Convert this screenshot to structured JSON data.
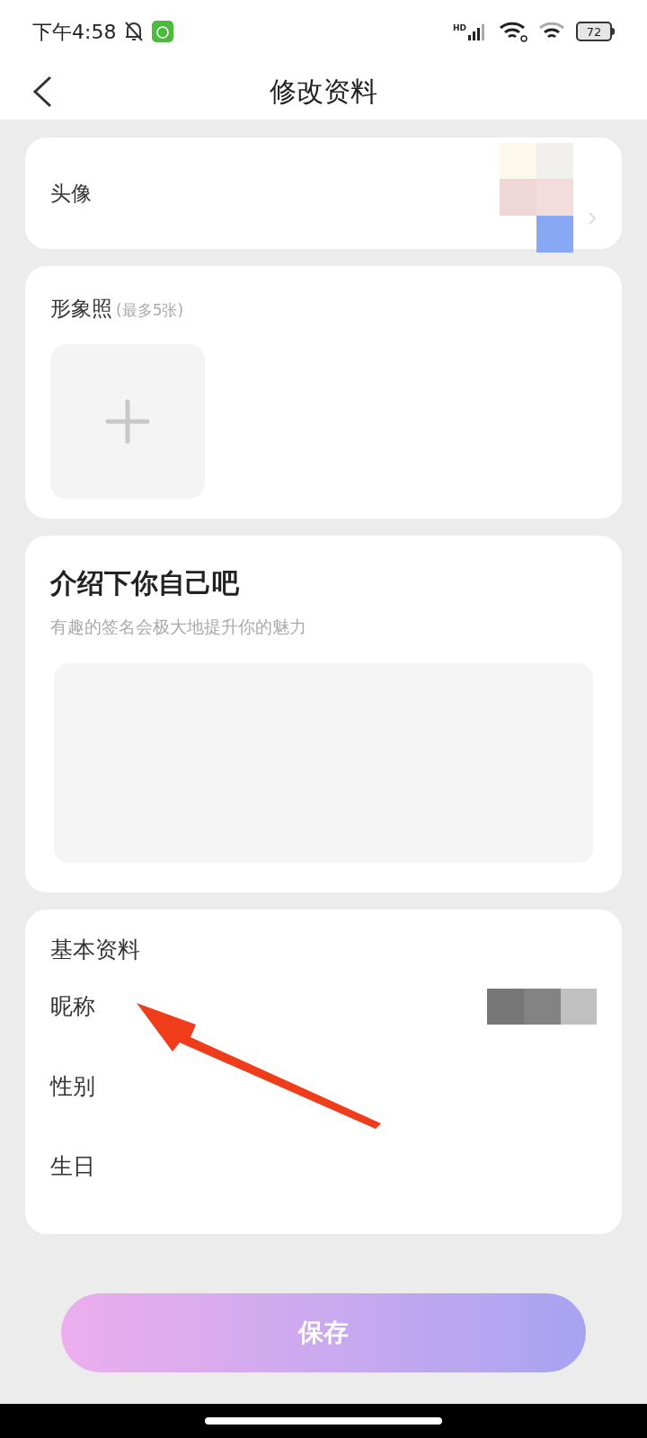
{
  "status_bar": {
    "time": "下午4:58",
    "network_label": "HD",
    "battery": "72"
  },
  "header": {
    "title": "修改资料"
  },
  "avatar_row": {
    "label": "头像"
  },
  "photos": {
    "title": "形象照",
    "hint": "(最多5张)"
  },
  "intro": {
    "title": "介绍下你自己吧",
    "subtitle": "有趣的签名会极大地提升你的魅力"
  },
  "basic_info": {
    "title": "基本资料",
    "rows": [
      {
        "label": "昵称",
        "kind": "redacted"
      },
      {
        "label": "性别",
        "kind": "empty"
      },
      {
        "label": "生日",
        "kind": "empty"
      }
    ]
  },
  "save_button": {
    "label": "保存"
  }
}
